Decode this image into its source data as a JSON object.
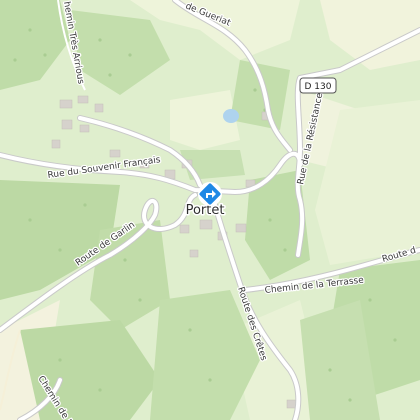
{
  "map": {
    "place_name": "Portet",
    "road_ref": "D 130",
    "roads": {
      "gueriat": "de Gueriat",
      "chemin_tres_arrious": "hemin Très Arrious",
      "souvenir": "Rue du Souvenir Français",
      "resistance": "Rue de la Résistance",
      "garlin": "Route de Garlin",
      "cretes": "Route des Crêtes",
      "terrasse": "Chemin de la Terrasse",
      "route_d": "Route d",
      "chemin_l": "Chemin de L"
    },
    "marker_icon": "map-pin-direction-icon",
    "colors": {
      "background": "#dfeecd",
      "forest": "#bfdca8",
      "meadow": "#e9f2d6",
      "farmland": "#f2f2dc",
      "water": "#aed3ee",
      "road": "#ffffff",
      "road_casing": "#c9c9c9",
      "building": "#d6d2cc",
      "marker": "#1e88e5"
    }
  }
}
